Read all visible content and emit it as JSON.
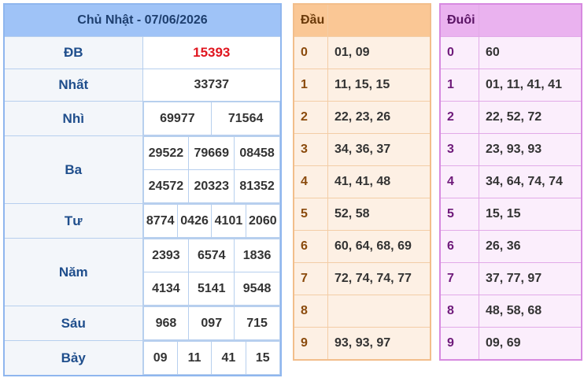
{
  "main": {
    "title": "Chủ Nhật - 07/06/2026",
    "db": {
      "label": "ĐB",
      "value": "15393"
    },
    "nhat": {
      "label": "Nhất",
      "value": "33737"
    },
    "nhi": {
      "label": "Nhì",
      "values": [
        "69977",
        "71564"
      ]
    },
    "ba": {
      "label": "Ba",
      "values": [
        "29522",
        "79669",
        "08458",
        "24572",
        "20323",
        "81352"
      ]
    },
    "tu": {
      "label": "Tư",
      "values": [
        "8774",
        "0426",
        "4101",
        "2060"
      ]
    },
    "nam": {
      "label": "Năm",
      "values": [
        "2393",
        "6574",
        "1836",
        "4134",
        "5141",
        "9548"
      ]
    },
    "sau": {
      "label": "Sáu",
      "values": [
        "968",
        "097",
        "715"
      ]
    },
    "bay": {
      "label": "Bảy",
      "values": [
        "09",
        "11",
        "41",
        "15"
      ]
    }
  },
  "dau": {
    "header": "Đầu",
    "rows": [
      {
        "d": "0",
        "v": "01, 09"
      },
      {
        "d": "1",
        "v": "11, 15, 15"
      },
      {
        "d": "2",
        "v": "22, 23, 26"
      },
      {
        "d": "3",
        "v": "34, 36, 37"
      },
      {
        "d": "4",
        "v": "41, 41, 48"
      },
      {
        "d": "5",
        "v": "52, 58"
      },
      {
        "d": "6",
        "v": "60, 64, 68, 69"
      },
      {
        "d": "7",
        "v": "72, 74, 74, 77"
      },
      {
        "d": "8",
        "v": ""
      },
      {
        "d": "9",
        "v": "93, 93, 97"
      }
    ]
  },
  "duoi": {
    "header": "Đuôi",
    "rows": [
      {
        "d": "0",
        "v": "60"
      },
      {
        "d": "1",
        "v": "01, 11, 41, 41"
      },
      {
        "d": "2",
        "v": "22, 52, 72"
      },
      {
        "d": "3",
        "v": "23, 93, 93"
      },
      {
        "d": "4",
        "v": "34, 64, 74, 74"
      },
      {
        "d": "5",
        "v": "15, 15"
      },
      {
        "d": "6",
        "v": "26, 36"
      },
      {
        "d": "7",
        "v": "37, 77, 97"
      },
      {
        "d": "8",
        "v": "48, 58, 68"
      },
      {
        "d": "9",
        "v": "09, 69"
      }
    ]
  }
}
